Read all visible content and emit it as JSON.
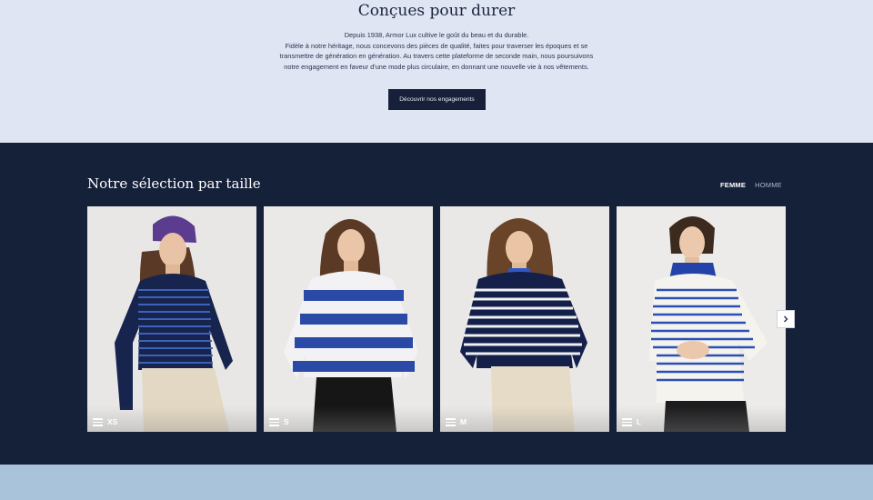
{
  "hero": {
    "title": "Conçues pour durer",
    "lines": [
      "Depuis 1938, Armor Lux cultive le goût du beau et du durable.",
      "Fidèle à notre héritage, nous concevons des pièces de qualité, faites pour traverser les époques et se",
      "transmettre de génération en génération. Au travers cette plateforme de seconde main, nous poursuivons",
      "notre engagement en faveur d'une mode plus circulaire, en donnant une nouvelle vie à nos vêtements."
    ],
    "button_label": "Découvrir nos engagements"
  },
  "selection": {
    "title": "Notre sélection par taille",
    "tabs": [
      "FEMME",
      "HOMME"
    ],
    "active_tab": "FEMME",
    "cards": [
      {
        "size": "XS"
      },
      {
        "size": "S"
      },
      {
        "size": "M"
      },
      {
        "size": "L"
      }
    ],
    "next_icon": "chevron-right-icon",
    "size_icon": "menu-icon"
  },
  "colors": {
    "hero_bg": "#dfe5f2",
    "band_bg": "#152039",
    "button_bg": "#162038",
    "bottom_strip": "#a9c3da"
  }
}
